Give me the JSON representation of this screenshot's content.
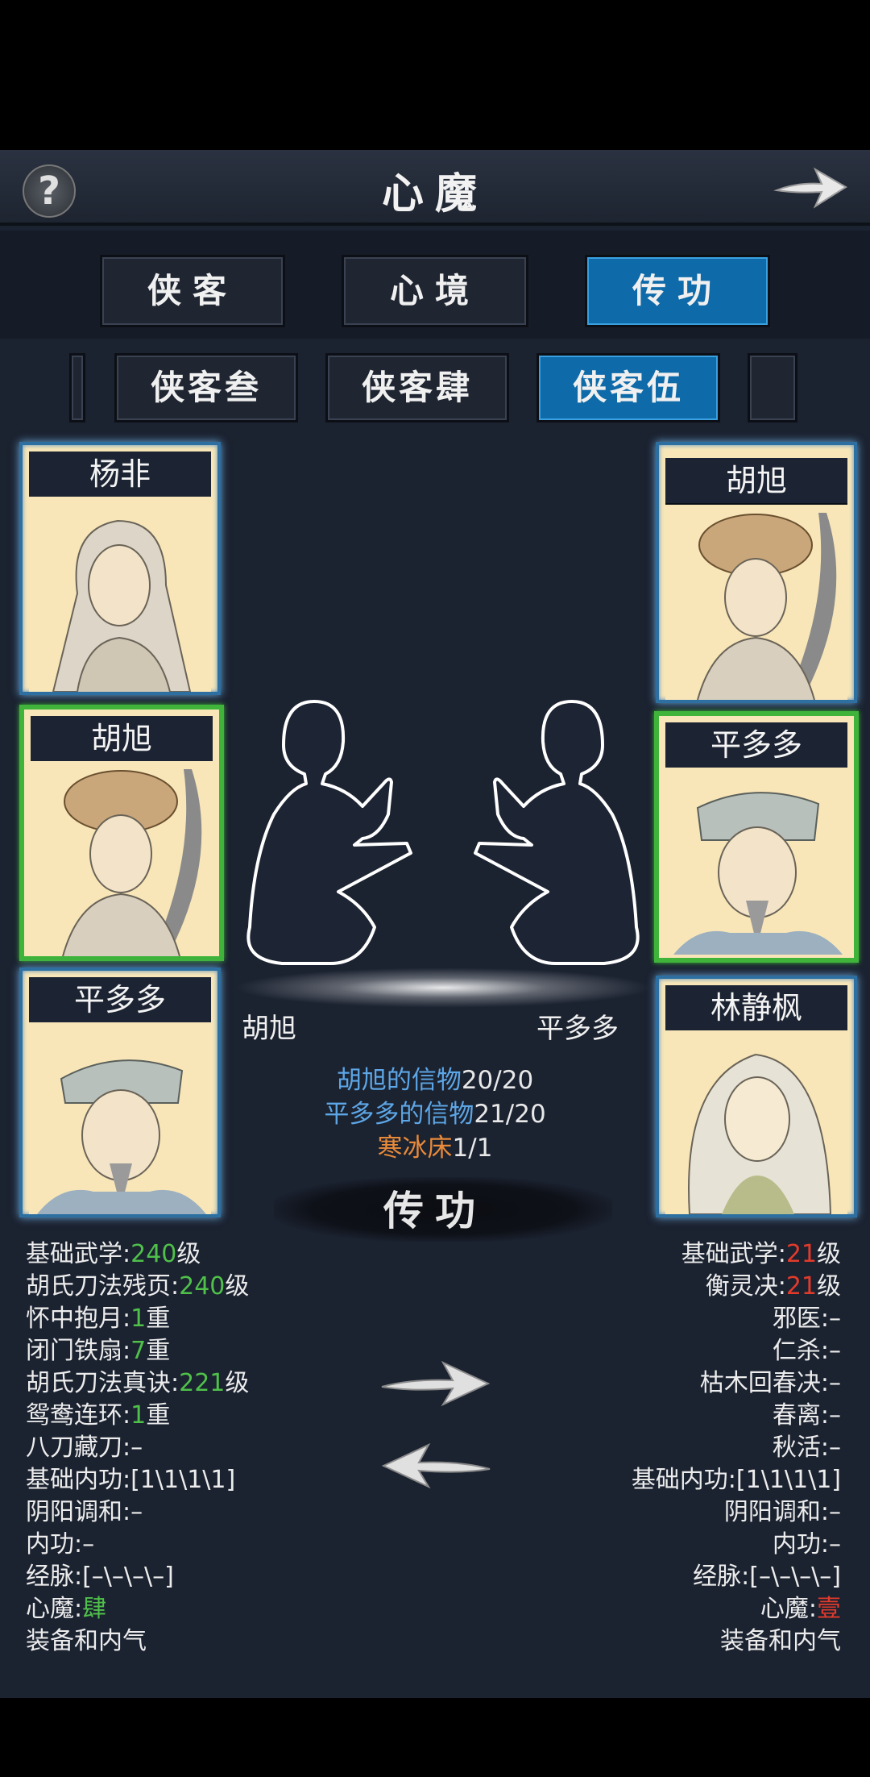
{
  "header": {
    "help_icon": "question-mark-icon",
    "title": "心魔",
    "next_icon": "right-arrow-icon"
  },
  "main_tabs": [
    {
      "label": "侠客",
      "active": false
    },
    {
      "label": "心境",
      "active": false
    },
    {
      "label": "传功",
      "active": true
    }
  ],
  "sub_tabs": [
    {
      "label": "侠客叁",
      "active": false
    },
    {
      "label": "侠客肆",
      "active": false
    },
    {
      "label": "侠客伍",
      "active": true
    }
  ],
  "left_roster": [
    {
      "name": "杨非",
      "selected": false
    },
    {
      "name": "胡旭",
      "selected": true
    },
    {
      "name": "平多多",
      "selected": false
    }
  ],
  "right_roster": [
    {
      "name": "胡旭",
      "selected": false
    },
    {
      "name": "平多多",
      "selected": true
    },
    {
      "name": "林静枫",
      "selected": false
    }
  ],
  "transfer": {
    "giver": "胡旭",
    "receiver": "平多多",
    "requirements": [
      {
        "label": "胡旭的信物",
        "value": "20/20",
        "color": "#5da6e6"
      },
      {
        "label": "平多多的信物",
        "value": "21/20",
        "color": "#5da6e6"
      },
      {
        "label": "寒冰床",
        "value": "1/1",
        "color": "#e88a3a"
      }
    ],
    "action_label": "传功"
  },
  "left_stats": [
    {
      "label": "基础武学:",
      "value": "240",
      "suffix": "级",
      "value_color": "green"
    },
    {
      "label": "胡氏刀法残页:",
      "value": "240",
      "suffix": "级",
      "value_color": "green"
    },
    {
      "label": "怀中抱月:",
      "value": "1",
      "suffix": "重",
      "value_color": "green"
    },
    {
      "label": "闭门铁扇:",
      "value": "7",
      "suffix": "重",
      "value_color": "green"
    },
    {
      "label": "胡氏刀法真诀:",
      "value": "221",
      "suffix": "级",
      "value_color": "green"
    },
    {
      "label": "鸳鸯连环:",
      "value": "1",
      "suffix": "重",
      "value_color": "green"
    },
    {
      "label": "八刀藏刀:–",
      "value": "",
      "suffix": "",
      "value_color": ""
    },
    {
      "label": "基础内功:[1\\1\\1\\1]",
      "value": "",
      "suffix": "",
      "value_color": ""
    },
    {
      "label": "阴阳调和:–",
      "value": "",
      "suffix": "",
      "value_color": ""
    },
    {
      "label": "内功:–",
      "value": "",
      "suffix": "",
      "value_color": ""
    },
    {
      "label": "经脉:[–\\–\\–\\–]",
      "value": "",
      "suffix": "",
      "value_color": ""
    },
    {
      "label": "心魔:",
      "value": "肆",
      "suffix": "",
      "value_color": "green"
    },
    {
      "label": "装备和内气",
      "value": "",
      "suffix": "",
      "value_color": ""
    }
  ],
  "right_stats": [
    {
      "label": "基础武学:",
      "value": "21",
      "suffix": "级",
      "value_color": "red"
    },
    {
      "label": "衡灵决:",
      "value": "21",
      "suffix": "级",
      "value_color": "red"
    },
    {
      "label": "邪医:–",
      "value": "",
      "suffix": "",
      "value_color": ""
    },
    {
      "label": "仁杀:–",
      "value": "",
      "suffix": "",
      "value_color": ""
    },
    {
      "label": "枯木回春决:–",
      "value": "",
      "suffix": "",
      "value_color": ""
    },
    {
      "label": "春离:–",
      "value": "",
      "suffix": "",
      "value_color": ""
    },
    {
      "label": "秋活:–",
      "value": "",
      "suffix": "",
      "value_color": ""
    },
    {
      "label": "基础内功:[1\\1\\1\\1]",
      "value": "",
      "suffix": "",
      "value_color": ""
    },
    {
      "label": "阴阳调和:–",
      "value": "",
      "suffix": "",
      "value_color": ""
    },
    {
      "label": "内功:–",
      "value": "",
      "suffix": "",
      "value_color": ""
    },
    {
      "label": "经脉:[–\\–\\–\\–]",
      "value": "",
      "suffix": "",
      "value_color": ""
    },
    {
      "label": "心魔:",
      "value": "壹",
      "suffix": "",
      "value_color": "red"
    },
    {
      "label": "装备和内气",
      "value": "",
      "suffix": "",
      "value_color": ""
    }
  ],
  "transfer_buttons": {
    "forward_icon": "right-arrow-icon",
    "backward_icon": "left-arrow-icon"
  }
}
